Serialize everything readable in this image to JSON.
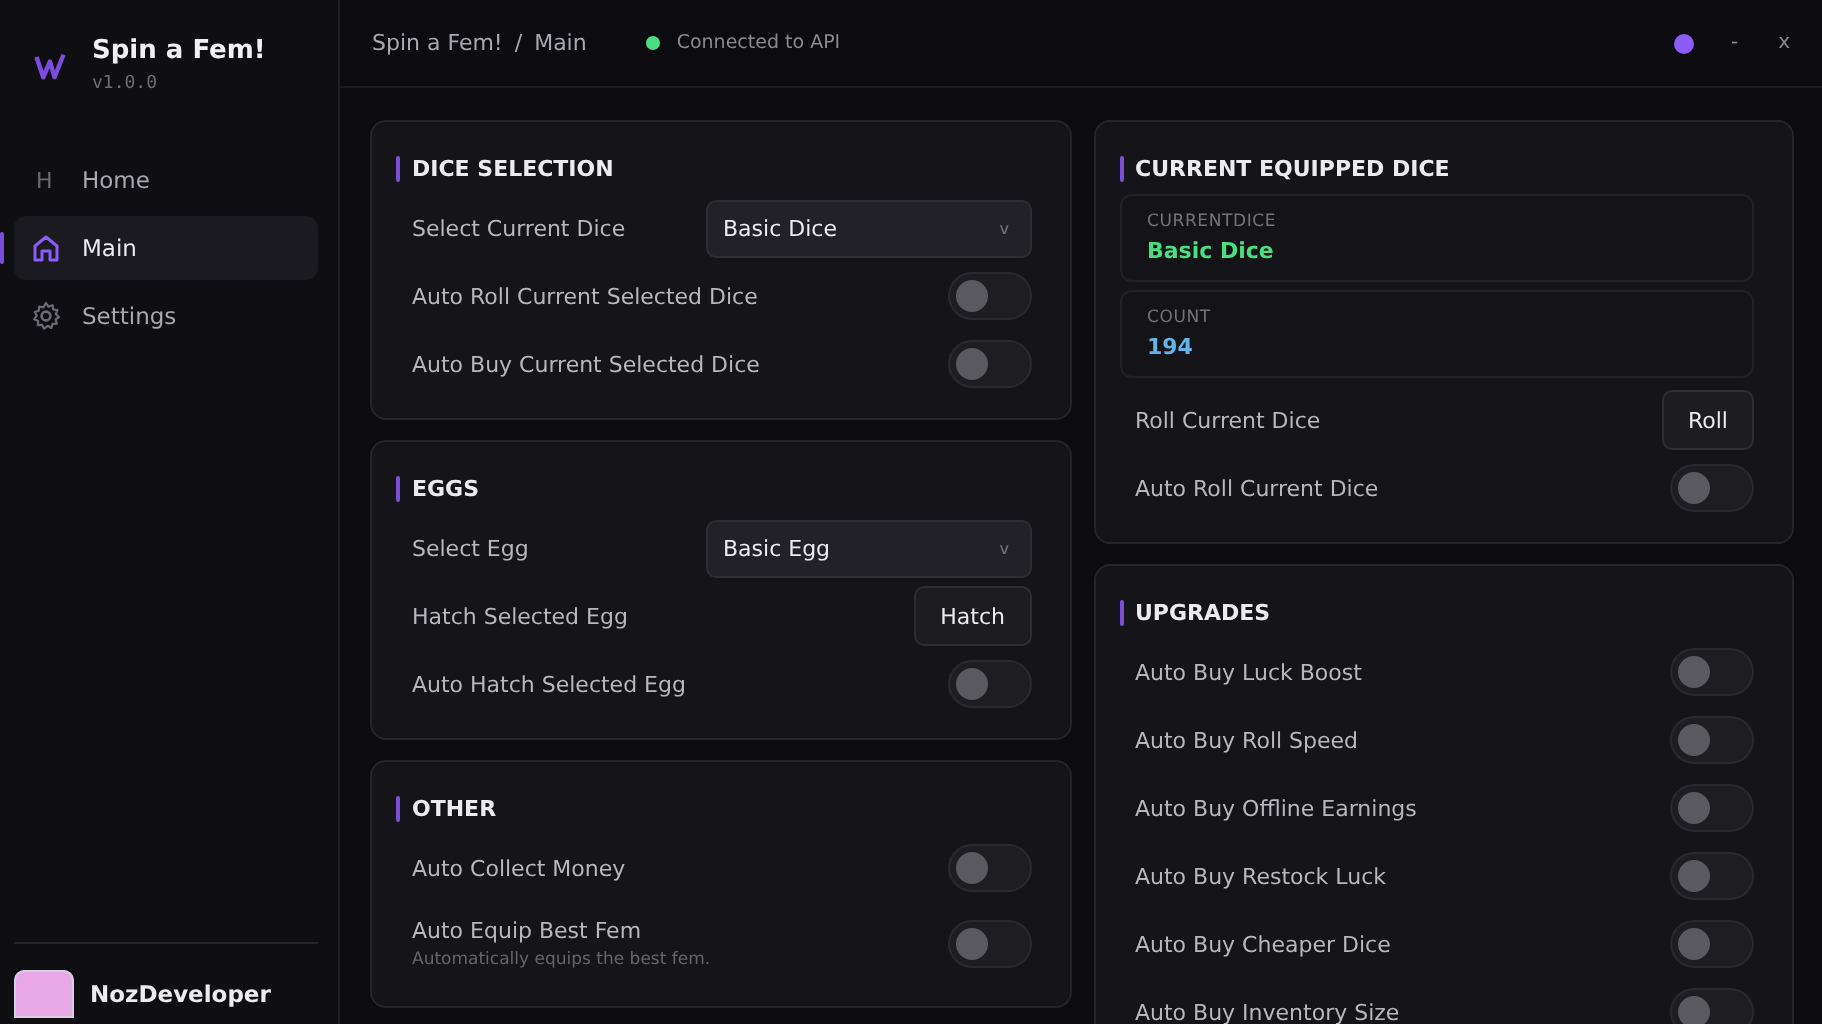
{
  "app": {
    "title": "Spin a Fem!",
    "version": "v1.0.0"
  },
  "sidebar": {
    "items": [
      {
        "label": "Home",
        "kind": "letter",
        "glyph": "H",
        "selected": false
      },
      {
        "label": "Main",
        "kind": "house",
        "selected": true
      },
      {
        "label": "Settings",
        "kind": "gear",
        "selected": false
      }
    ],
    "user": {
      "name": "NozDeveloper"
    }
  },
  "header": {
    "breadcrumb": [
      "Spin a Fem!",
      "/",
      "Main"
    ],
    "status": {
      "text": "Connected to API",
      "connected": true
    },
    "window_controls": [
      "-",
      "x"
    ]
  },
  "columns": [
    [
      {
        "title": "DICE SELECTION",
        "rows": [
          {
            "kind": "dropdown",
            "label": "Select Current Dice",
            "value": "Basic Dice",
            "caret": "v"
          },
          {
            "kind": "toggle",
            "label": "Auto Roll Current Selected Dice",
            "on": false
          },
          {
            "kind": "toggle",
            "label": "Auto Buy Current Selected Dice",
            "on": false
          }
        ]
      },
      {
        "title": "EGGS",
        "rows": [
          {
            "kind": "dropdown",
            "label": "Select Egg",
            "value": "Basic Egg",
            "caret": "v"
          },
          {
            "kind": "button",
            "label": "Hatch Selected Egg",
            "button": "Hatch"
          },
          {
            "kind": "toggle",
            "label": "Auto Hatch Selected Egg",
            "on": false
          }
        ]
      },
      {
        "title": "OTHER",
        "rows": [
          {
            "kind": "toggle",
            "label": "Auto Collect Money",
            "on": false
          },
          {
            "kind": "toggle",
            "label": "Auto Equip Best Fem",
            "description": "Automatically equips the best fem.",
            "on": false
          }
        ]
      }
    ],
    [
      {
        "title": "CURRENT EQUIPPED DICE",
        "rows": [
          {
            "kind": "stat",
            "label": "CURRENTDICE",
            "value": "Basic Dice",
            "color": "#4ade80"
          },
          {
            "kind": "stat",
            "label": "COUNT",
            "value": "194",
            "color": "#60b4e8"
          },
          {
            "kind": "button",
            "label": "Roll Current Dice",
            "button": "Roll"
          },
          {
            "kind": "toggle",
            "label": "Auto Roll Current Dice",
            "on": false
          }
        ]
      },
      {
        "title": "UPGRADES",
        "rows": [
          {
            "kind": "toggle",
            "label": "Auto Buy Luck Boost",
            "on": false
          },
          {
            "kind": "toggle",
            "label": "Auto Buy Roll Speed",
            "on": false
          },
          {
            "kind": "toggle",
            "label": "Auto Buy Offline Earnings",
            "on": false
          },
          {
            "kind": "toggle",
            "label": "Auto Buy Restock Luck",
            "on": false
          },
          {
            "kind": "toggle",
            "label": "Auto Buy Cheaper Dice",
            "on": false
          },
          {
            "kind": "toggle",
            "label": "Auto Buy Inventory Size",
            "on": false
          }
        ]
      }
    ]
  ]
}
